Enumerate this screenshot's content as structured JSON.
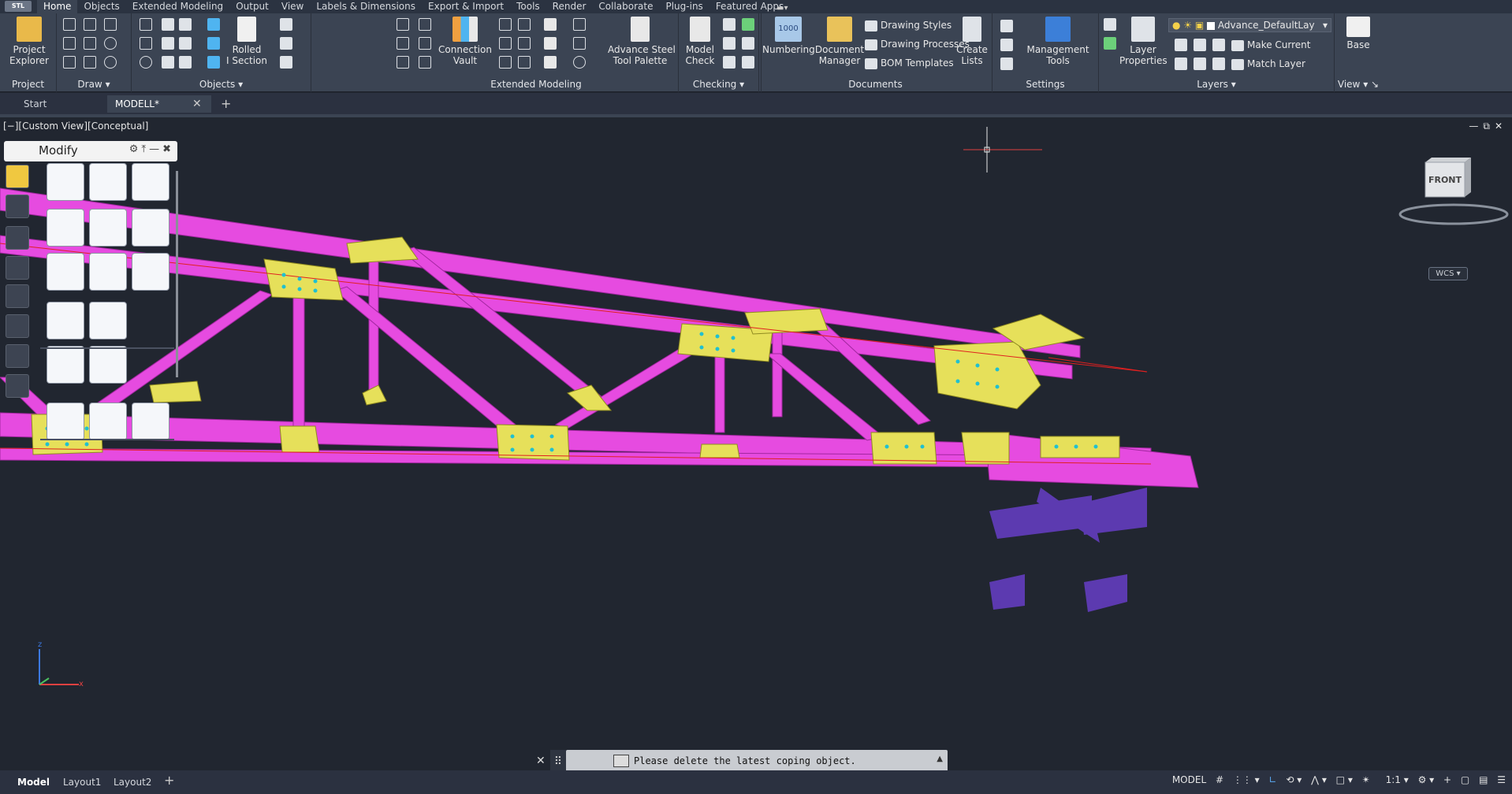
{
  "app_button": "STL",
  "menu_tabs": [
    "Home",
    "Objects",
    "Extended Modeling",
    "Output",
    "View",
    "Labels & Dimensions",
    "Export & Import",
    "Tools",
    "Render",
    "Collaborate",
    "Plug-ins",
    "Featured Apps"
  ],
  "ribbon": {
    "project": {
      "title": "Project",
      "explorer_line1": "Project",
      "explorer_line2": "Explorer"
    },
    "draw": {
      "title": "Draw"
    },
    "objects": {
      "title": "Objects",
      "rolled_line1": "Rolled",
      "rolled_line2": "I Section"
    },
    "extended": {
      "title": "Extended Modeling",
      "vault_line1": "Connection",
      "vault_line2": "Vault",
      "palette_line1": "Advance Steel",
      "palette_line2": "Tool Palette"
    },
    "checking": {
      "title": "Checking",
      "model_line1": "Model",
      "model_line2": "Check"
    },
    "documents": {
      "title": "Documents",
      "numbering": "Numbering",
      "numbering_badge": "1000",
      "docman_line1": "Document",
      "docman_line2": "Manager",
      "drawing_styles": "Drawing Styles",
      "drawing_processes": "Drawing Processes",
      "bom_templates": "BOM Templates",
      "create_line1": "Create",
      "create_line2": "Lists"
    },
    "settings": {
      "title": "Settings",
      "mgmt_line1": "Management",
      "mgmt_line2": "Tools"
    },
    "layers": {
      "title": "Layers",
      "props_line1": "Layer",
      "props_line2": "Properties",
      "current_layer": "Advance_DefaultLay",
      "make_current": "Make Current",
      "match_layer": "Match Layer"
    },
    "view": {
      "title": "View",
      "base": "Base"
    }
  },
  "doc_tabs": {
    "start": "Start",
    "model": "MODELL*"
  },
  "viewport": {
    "label": "[−][Custom View][Conceptual]"
  },
  "palette": {
    "title": "Modify"
  },
  "viewcube": {
    "face": "FRONT",
    "wcs": "WCS"
  },
  "command": {
    "message": "Please delete the latest coping object."
  },
  "layout_tabs": [
    "Model",
    "Layout1",
    "Layout2"
  ],
  "status": {
    "mode": "MODEL",
    "scale": "1:1"
  },
  "colors": {
    "steel": "#e64be0",
    "plates": "#e6e05a",
    "purple": "#8a45e8",
    "axis": "#e02020"
  }
}
